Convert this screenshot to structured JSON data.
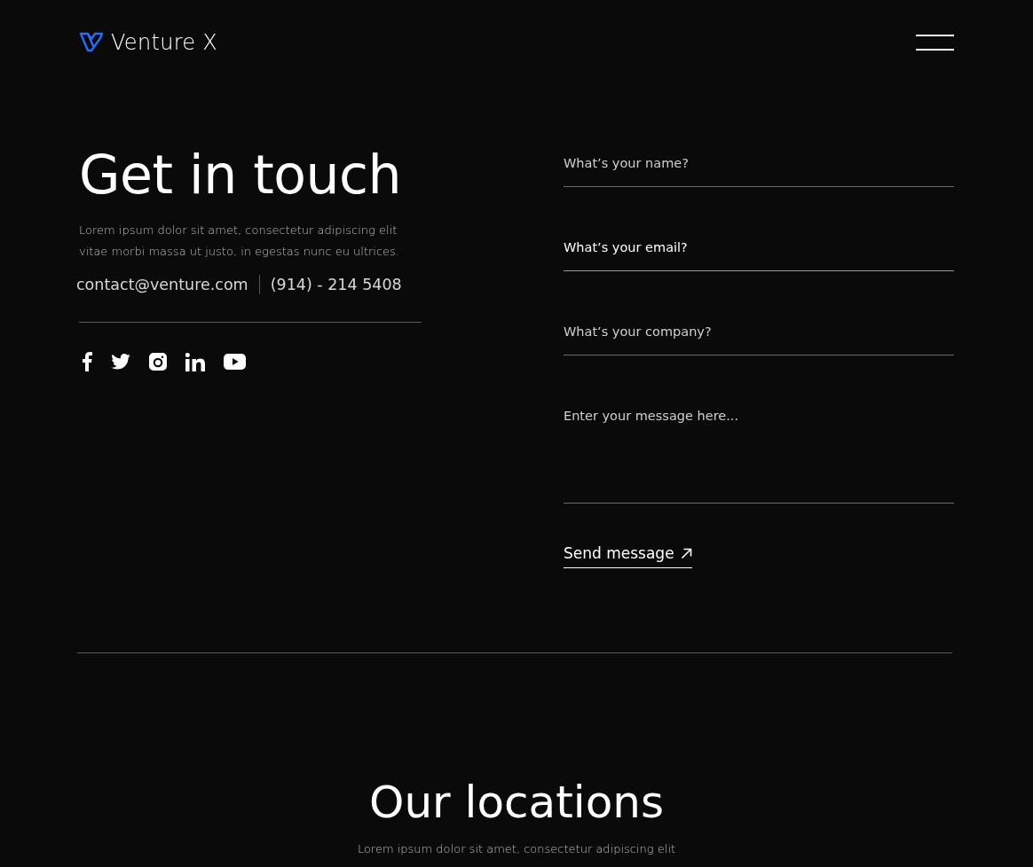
{
  "header": {
    "brand": "Venture X"
  },
  "contact": {
    "title": "Get in touch",
    "text": "Lorem ipsum dolor sit amet, consectetur adipiscing elit vitae morbi massa ut justo, in egestas nunc eu ultrices.",
    "email": "contact@venture.com",
    "phone": "(914) - 214 5408",
    "socials": [
      {
        "kind": "facebook"
      },
      {
        "kind": "twitter"
      },
      {
        "kind": "instagram"
      },
      {
        "kind": "linkedin"
      },
      {
        "kind": "youtube"
      }
    ]
  },
  "form": {
    "fields": [
      {
        "kind": "input",
        "placeholder": "What’s your name?",
        "focused": false
      },
      {
        "kind": "input",
        "placeholder": "What’s your email?",
        "focused": true
      },
      {
        "kind": "input",
        "placeholder": "What’s your company?",
        "focused": false
      },
      {
        "kind": "textarea",
        "placeholder": "Enter your message here...",
        "focused": false
      }
    ],
    "submit": "Send message"
  },
  "locations": {
    "title": "Our locations",
    "text": "Lorem ipsum dolor sit amet, consectetur adipiscing elit"
  }
}
